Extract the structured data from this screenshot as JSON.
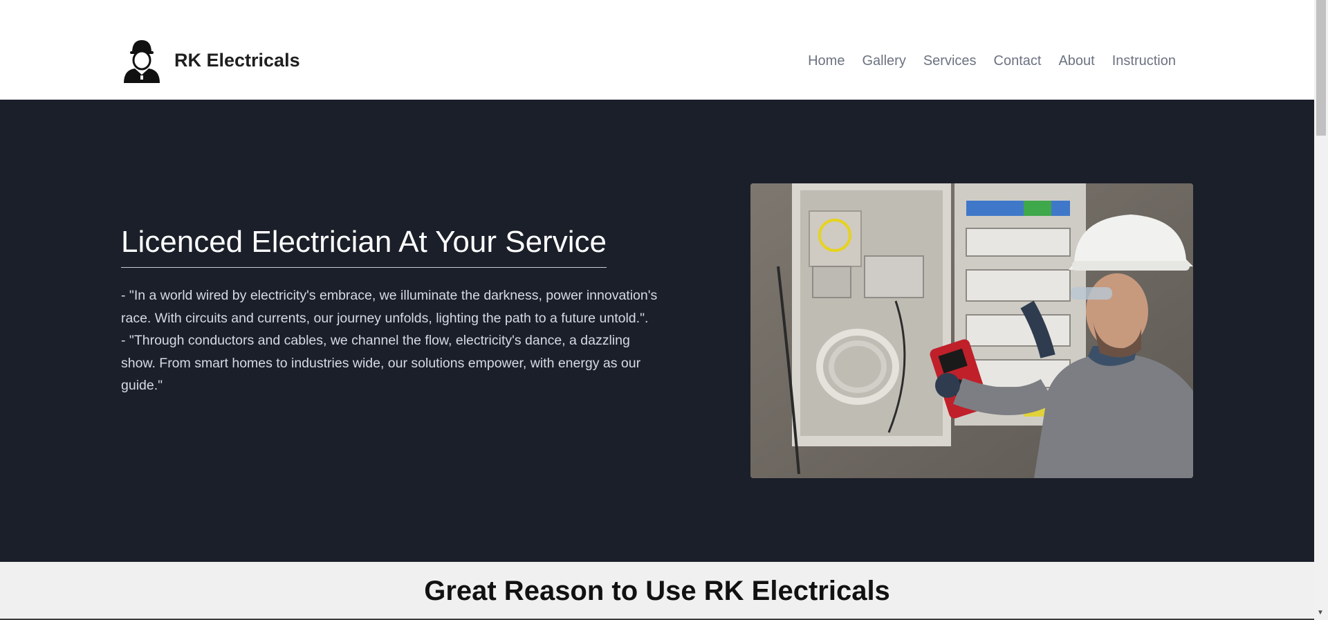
{
  "header": {
    "brand_name": "RK Electricals",
    "logo_icon": "electrician-avatar-icon",
    "nav": [
      {
        "label": "Home"
      },
      {
        "label": "Gallery"
      },
      {
        "label": "Services"
      },
      {
        "label": "Contact"
      },
      {
        "label": "About"
      },
      {
        "label": "Instruction"
      }
    ]
  },
  "hero": {
    "title": "Licenced Electrician At Your Service",
    "paragraphs": [
      "- \"In a world wired by electricity's embrace, we illuminate the darkness, power innovation's race. With circuits and currents, our journey unfolds, lighting the path to a future untold.\".",
      "- \"Through conductors and cables, we channel the flow, electricity's dance, a dazzling show. From smart homes to industries wide, our solutions empower, with energy as our guide.\""
    ],
    "image_icon": "electrician-at-panel-photo"
  },
  "reasons": {
    "title": "Great Reason to Use RK Electricals"
  },
  "colors": {
    "hero_bg": "#1b1f2a",
    "nav_text": "#6b7280",
    "reasons_bg": "#f0f0f0"
  }
}
